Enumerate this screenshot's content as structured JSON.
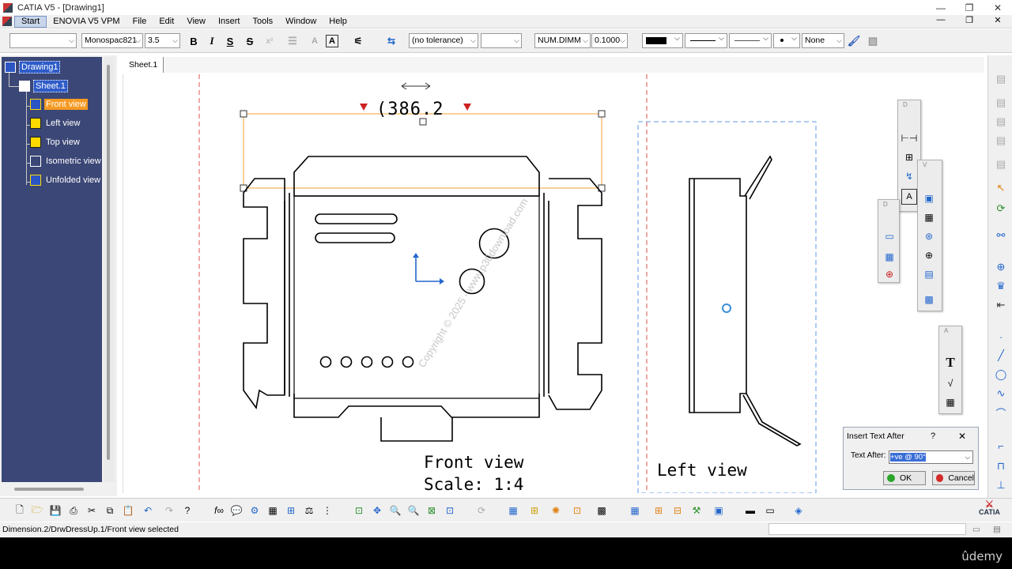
{
  "window": {
    "title": "CATIA V5 - [Drawing1]",
    "controls": [
      "—",
      "❐",
      "✕"
    ]
  },
  "menubar": {
    "items": [
      "Start",
      "ENOVIA V5 VPM",
      "File",
      "Edit",
      "View",
      "Insert",
      "Tools",
      "Window",
      "Help"
    ],
    "controls": [
      "—",
      "❐",
      "✕"
    ]
  },
  "format_toolbar": {
    "style_combo": "",
    "font_name": "Monospac821",
    "font_size": "3.5",
    "bold_label": "B",
    "italic_label": "I",
    "underline_label": "S",
    "strike_label": "S",
    "tolerance": "(no tolerance)",
    "tolerance_value": "",
    "num_format": "NUM.DIMM",
    "precision": "0.1000",
    "line_none": "None"
  },
  "tree": {
    "nodes": [
      {
        "label": "Drawing1",
        "icon": "drawing-icon",
        "state": "selected-blue"
      },
      {
        "label": "Sheet.1",
        "icon": "sheet-icon",
        "state": "selected-blue"
      },
      {
        "label": "Front view",
        "icon": "front-view-icon",
        "state": "selected-orange"
      },
      {
        "label": "Left view",
        "icon": "left-view-icon",
        "state": "normal"
      },
      {
        "label": "Top view",
        "icon": "top-view-icon",
        "state": "normal"
      },
      {
        "label": "Isometric view",
        "icon": "isometric-view-icon",
        "state": "normal"
      },
      {
        "label": "Unfolded view",
        "icon": "unfolded-view-icon",
        "state": "normal"
      }
    ]
  },
  "sheet_tab": "Sheet.1",
  "drawing": {
    "dimension_text": "(386.2",
    "front_view_title": "Front view",
    "front_view_scale": "Scale:  1:4",
    "left_view_title": "Left view",
    "watermark": "Copyright © 2025 - www.p30download.com",
    "colors": {
      "selection": "#f0a030",
      "frame_dashed": "#e05050",
      "view_frame": "#5b9bea",
      "axis": "#2266cc",
      "arrow_red": "#cc2222"
    }
  },
  "floating_toolbars": {
    "dimension_head": "D",
    "views_head": "V",
    "dress_head": "D",
    "annotation_head": "A"
  },
  "dialog": {
    "title": "Insert Text After",
    "help": "?",
    "close": "✕",
    "label": "Text After:",
    "value": "+ve @ 90°",
    "ok": "OK",
    "cancel": "Cancel"
  },
  "status": {
    "text": "Dimension.2/DrwDressUp.1/Front view selected"
  },
  "brand": {
    "catia": "CATIA",
    "overlay": "ûdemy"
  }
}
